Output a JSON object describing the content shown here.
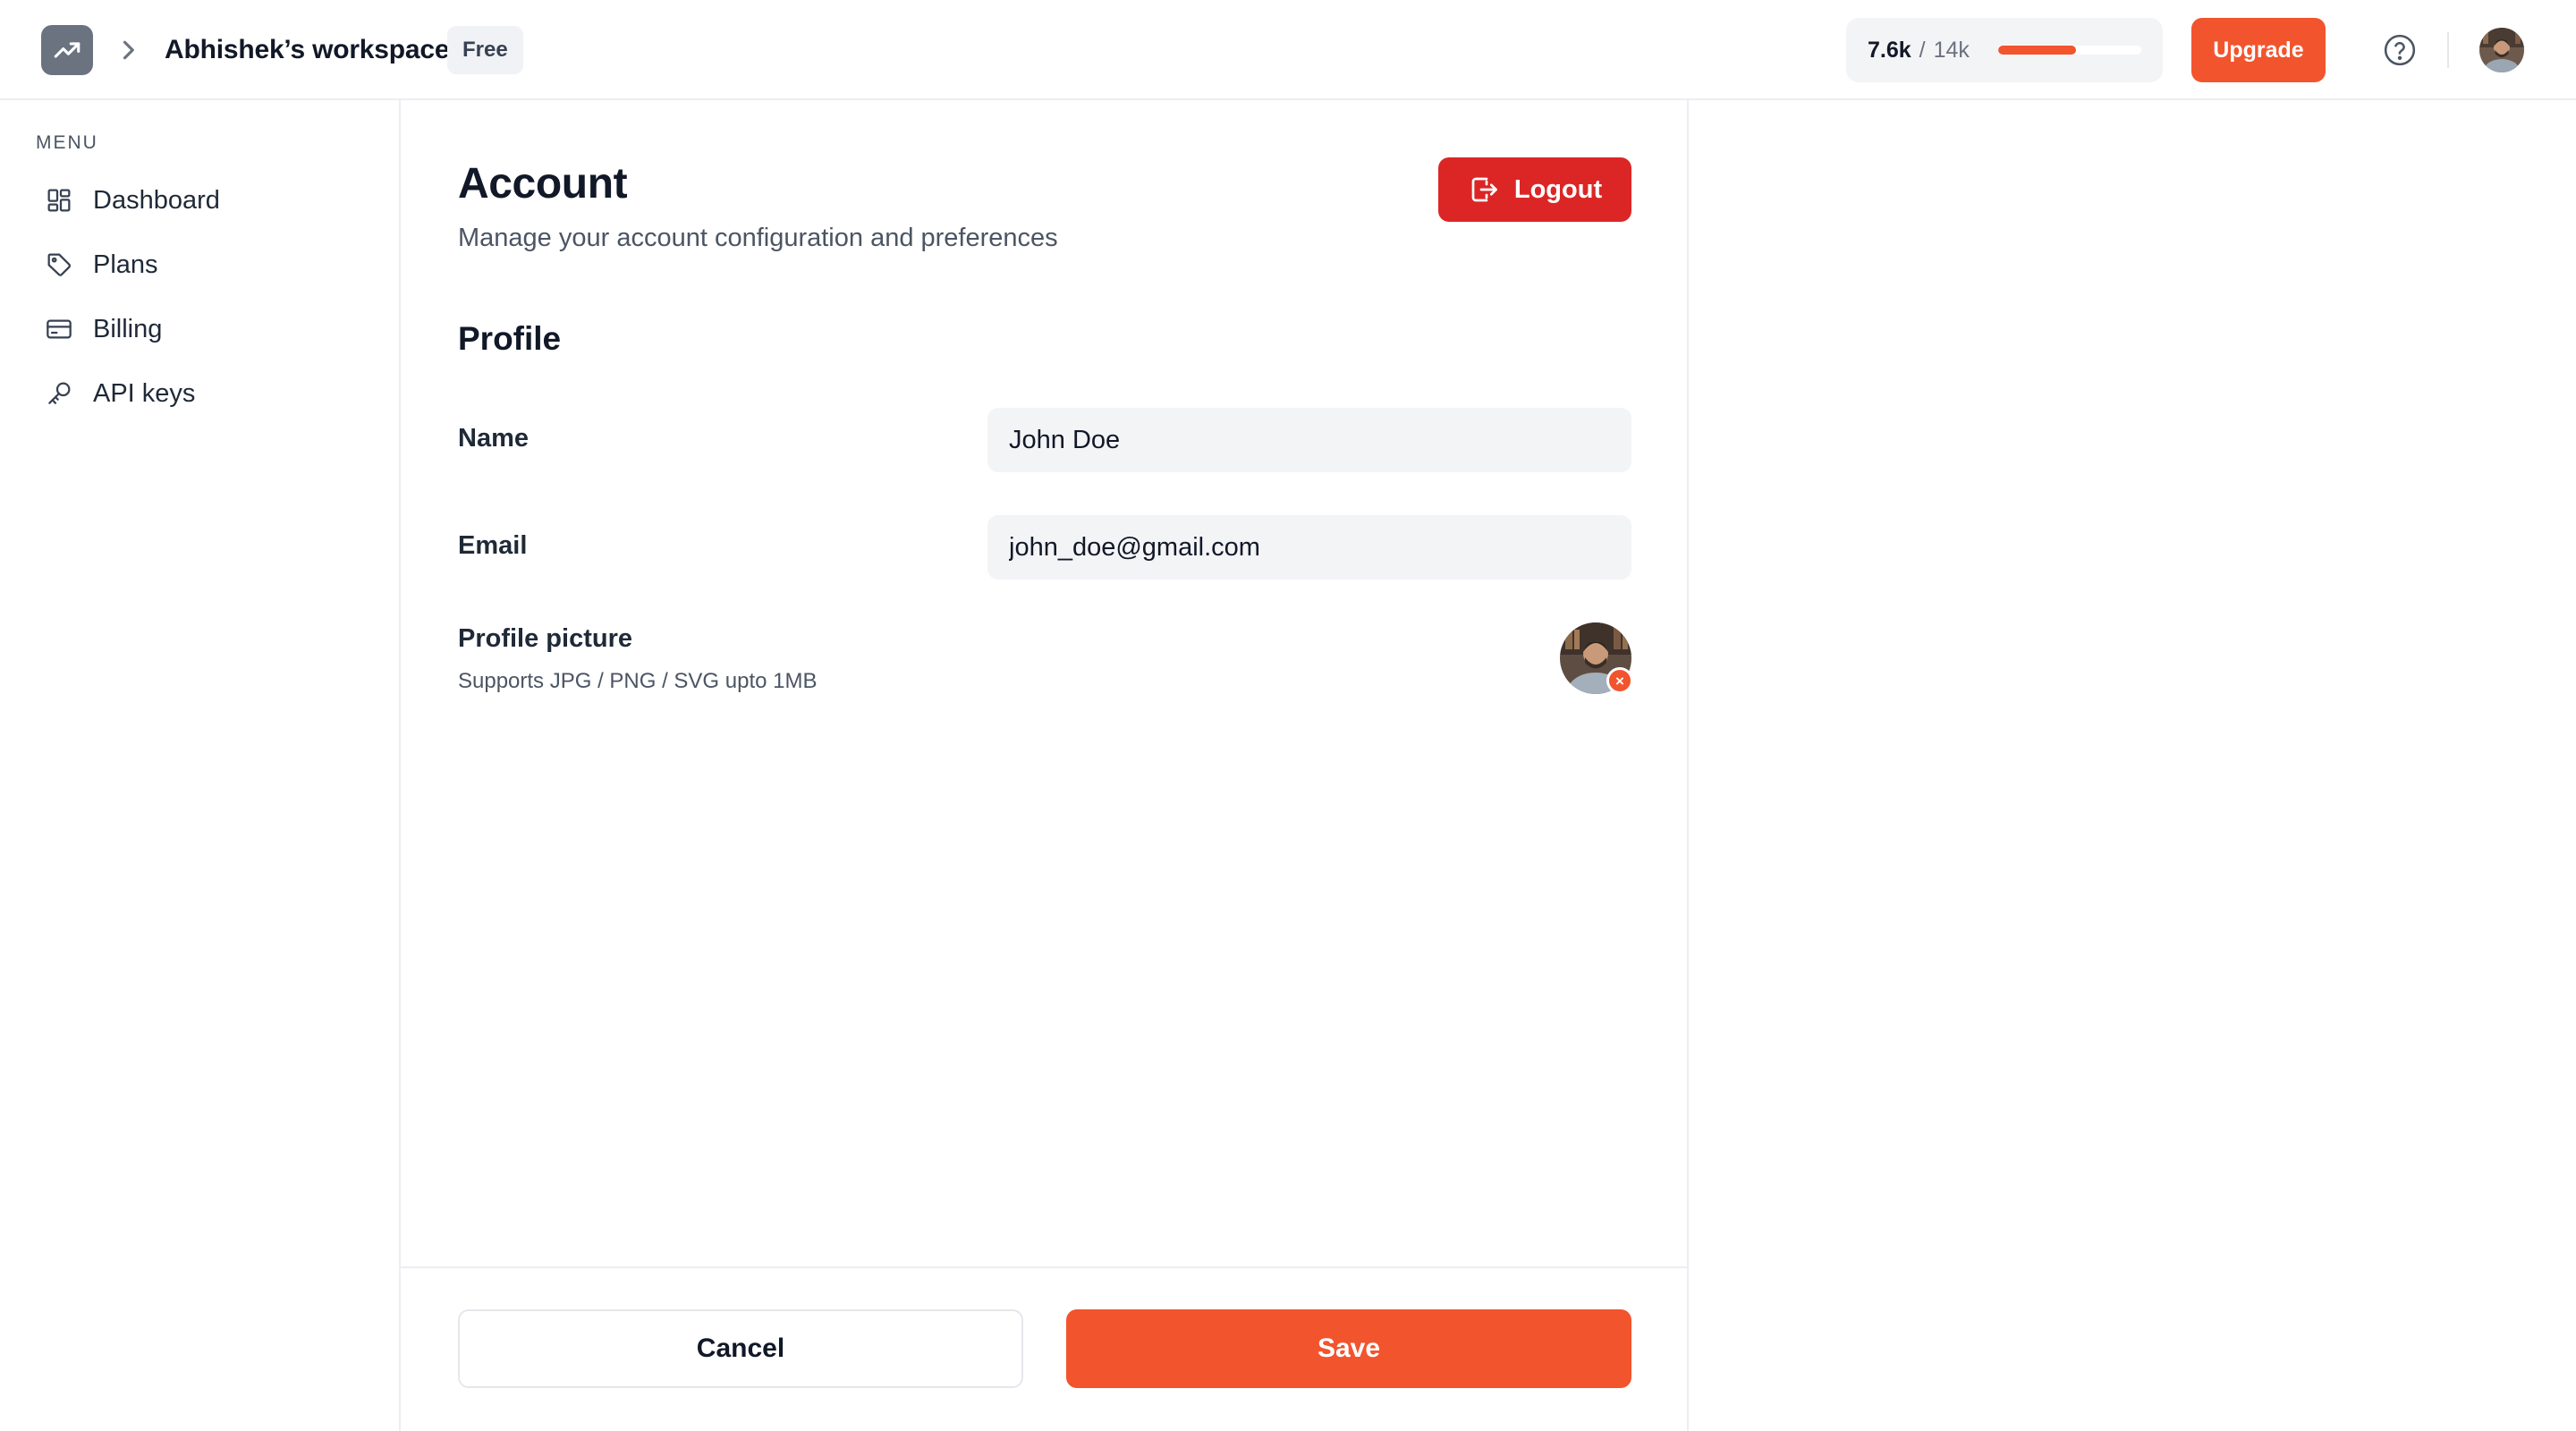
{
  "header": {
    "workspace_name": "Abhishek’s workspace",
    "plan_badge": "Free",
    "usage": {
      "used": "7.6k",
      "separator": "/",
      "total": "14k",
      "fraction": 0.543
    },
    "upgrade_label": "Upgrade",
    "icons": {
      "logo": "trending-up-icon",
      "chevron": "chevron-right-icon",
      "help": "help-circle-icon"
    }
  },
  "sidebar": {
    "menu_title": "MENU",
    "items": [
      {
        "label": "Dashboard",
        "icon": "dashboard-grid-icon"
      },
      {
        "label": "Plans",
        "icon": "tag-icon"
      },
      {
        "label": "Billing",
        "icon": "credit-card-icon"
      },
      {
        "label": "API keys",
        "icon": "key-icon"
      }
    ]
  },
  "account": {
    "title": "Account",
    "subtitle": "Manage your account configuration and preferences",
    "logout_label": "Logout",
    "profile_section": "Profile",
    "fields": {
      "name": {
        "label": "Name",
        "value": "John Doe"
      },
      "email": {
        "label": "Email",
        "value": "john_doe@gmail.com"
      }
    },
    "picture": {
      "label": "Profile picture",
      "help": "Supports JPG / PNG / SVG upto 1MB",
      "remove_glyph": "×"
    },
    "cancel_label": "Cancel",
    "save_label": "Save"
  },
  "colors": {
    "accent": "#f2542d",
    "danger": "#dc2626",
    "logo_bg": "#6b7280",
    "input_bg": "#f3f4f6"
  }
}
